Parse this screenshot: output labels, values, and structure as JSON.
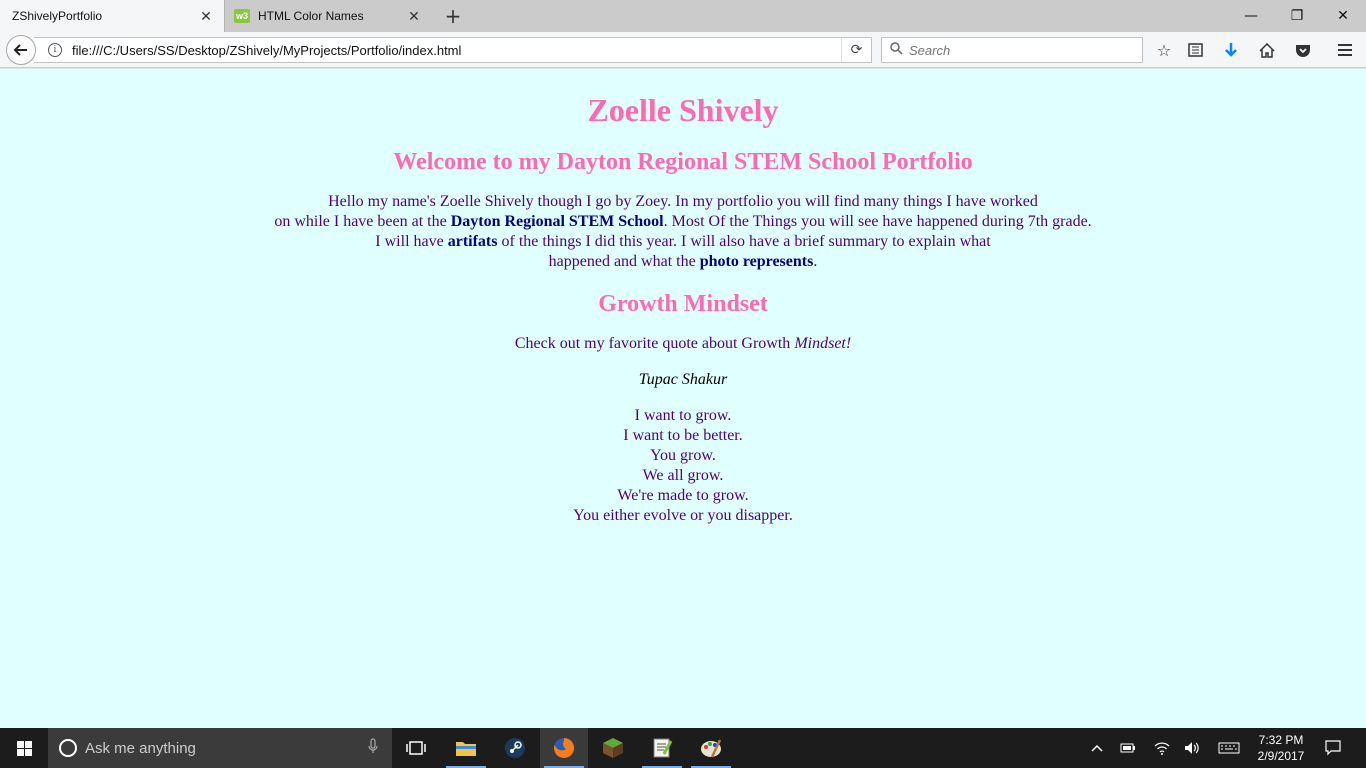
{
  "browser": {
    "tabs": [
      {
        "title": "ZShivelyPortfolio",
        "active": true
      },
      {
        "title": "HTML Color Names",
        "active": false,
        "favicon": "w3"
      }
    ],
    "url": "file:///C:/Users/SS/Desktop/ZShively/MyProjects/Portfolio/index.html",
    "search_placeholder": "Search"
  },
  "page": {
    "title": "Zoelle Shively",
    "welcome_heading": "Welcome to my Dayton Regional STEM School Portfolio",
    "intro": {
      "line1": "Hello my name's Zoelle Shively though I go by Zoey. In my portfolio you will find many things I have worked",
      "line2_a": "on while I have been at the ",
      "line2_bold": "Dayton Regional STEM School",
      "line2_b": ". Most Of the Things you will see have happened during 7th grade.",
      "line3_a": "I will have ",
      "line3_bold": "artifats",
      "line3_b": " of the things I did this year. I will also have a brief summary to explain what",
      "line4_a": "happened and what the ",
      "line4_bold": "photo represents",
      "line4_b": "."
    },
    "growth_heading": "Growth Mindset",
    "quote_intro": "Check out my favorite quote about Growth ",
    "quote_intro_em": "Mindset!",
    "quote_author": "Tupac Shakur",
    "quote_lines": [
      "I want to grow.",
      "I want to be better.",
      "You grow.",
      "We all grow.",
      "We're made to grow.",
      "You either evolve or you disapper."
    ]
  },
  "taskbar": {
    "search_placeholder": "Ask me anything",
    "time": "7:32 PM",
    "date": "2/9/2017"
  },
  "colors": {
    "page_background": "#e0ffff",
    "heading": "#ff69b4",
    "body_text": "#4b0082",
    "bold_text": "#000080"
  }
}
